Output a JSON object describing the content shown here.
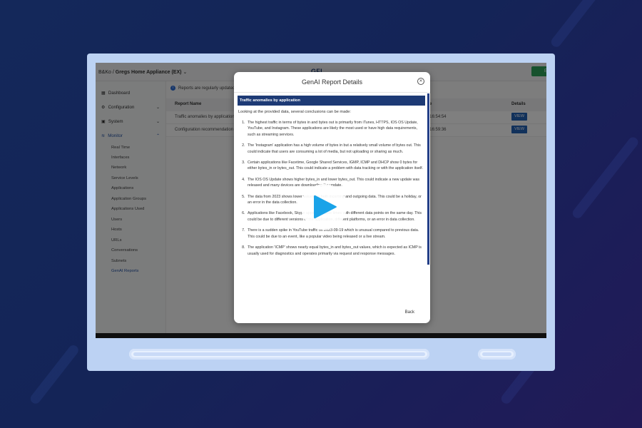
{
  "app": {
    "breadcrumb_org": "B&Ko",
    "breadcrumb_sep": "/",
    "breadcrumb_appliance": "Gregs Home Appliance (EX)",
    "brand": "GFI",
    "top_button": "E"
  },
  "sidebar": {
    "items": [
      {
        "label": "Dashboard"
      },
      {
        "label": "Configuration"
      },
      {
        "label": "System"
      },
      {
        "label": "Monitor"
      }
    ],
    "sub_items": [
      "Real Time",
      "Interfaces",
      "Network",
      "Service Levels",
      "Applications",
      "Application Groups",
      "Applications Used",
      "Users",
      "Hosts",
      "URLs",
      "Conversations",
      "Subnets",
      "GenAI Reports"
    ]
  },
  "main": {
    "info_text": "Reports are regularly updated",
    "columns": {
      "name": "Report Name",
      "date": "te",
      "details": "Details"
    },
    "rows": [
      {
        "name": "Traffic anomalies by application",
        "date": "'9 16:54:54",
        "action": "VIEW"
      },
      {
        "name": "Configuration recommendation",
        "date": "'9 16:59:36",
        "action": "VIEW"
      }
    ]
  },
  "modal": {
    "title": "GenAI Report Details",
    "banner": "Traffic anomalies by application",
    "intro": "Looking at the provided data, several conclusions can be made:",
    "points": [
      "The highest traffic in terms of bytes in and bytes out is primarily from iTunes, HTTPS, IOS OS Update, YouTube, and Instagram. These applications are likely the most used or have high data requirements, such as streaming services.",
      "The 'Instagram' application has a high volume of bytes in but a relatively small volume of bytes out. This could indicate that users are consuming a lot of media, but not uploading or sharing as much.",
      "Certain applications like Facetime, Google Shared Services, IGMP, ICMP and DHCP show 0 bytes for either bytes_in or bytes_out. This could indicate a problem with data tracking or with the application itself.",
      "The IOS OS Update shows higher bytes_in and lower bytes_out. This could indicate a new update was released and many devices are downloading the update.",
      "The data from 2023 shows lower values for both incoming and outgoing data. This could be a holiday, or an error in the data collection.",
      "Applications like Facebook, Skype appear multiple times with different data points on the same day. This could be due to different versions of the application, different platforms, or an error in data collection.",
      "There is a sudden spike in YouTube traffic on 2023-09-19 which is unusual compared to previous data. This could be due to an event, like a popular video being released or a live stream.",
      "The application 'ICMP' shows nearly equal bytes_in and bytes_out values, which is expected as ICMP is usually used for diagnostics and operates primarily via request and response messages."
    ],
    "back_label": "Back"
  },
  "colors": {
    "accent": "#2362b6",
    "banner": "#1d3a75",
    "background": "#14285a",
    "frame": "#bcd2f3",
    "play": "#1aa3e8"
  },
  "icons": [
    "dashboard-icon",
    "configuration-icon",
    "system-icon",
    "monitor-icon",
    "close-icon",
    "play-icon",
    "info-icon"
  ]
}
